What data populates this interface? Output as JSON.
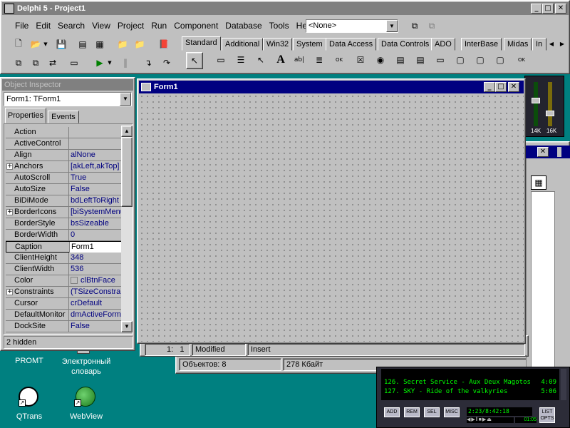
{
  "main_window": {
    "title": "Delphi 5 - Project1",
    "menu": [
      "File",
      "Edit",
      "Search",
      "View",
      "Project",
      "Run",
      "Component",
      "Database",
      "Tools",
      "Help"
    ],
    "component_combo": "<None>",
    "palette_tabs": [
      "Standard",
      "Additional",
      "Win32",
      "System",
      "Data Access",
      "Data Controls",
      "ADO",
      "InterBase",
      "Midas",
      "In"
    ],
    "palette_icon_letter": "A"
  },
  "object_inspector": {
    "title": "Object Inspector",
    "selected": "Form1: TForm1",
    "tabs": [
      "Properties",
      "Events"
    ],
    "rows": [
      {
        "name": "Action",
        "value": ""
      },
      {
        "name": "ActiveControl",
        "value": ""
      },
      {
        "name": "Align",
        "value": "alNone"
      },
      {
        "name": "Anchors",
        "value": "[akLeft,akTop]",
        "expand": "+"
      },
      {
        "name": "AutoScroll",
        "value": "True"
      },
      {
        "name": "AutoSize",
        "value": "False"
      },
      {
        "name": "BiDiMode",
        "value": "bdLeftToRight"
      },
      {
        "name": "BorderIcons",
        "value": "[biSystemMenu,",
        "expand": "+"
      },
      {
        "name": "BorderStyle",
        "value": "bsSizeable"
      },
      {
        "name": "BorderWidth",
        "value": "0"
      },
      {
        "name": "Caption",
        "value": "Form1"
      },
      {
        "name": "ClientHeight",
        "value": "348"
      },
      {
        "name": "ClientWidth",
        "value": "536"
      },
      {
        "name": "Color",
        "value": "clBtnFace"
      },
      {
        "name": "Constraints",
        "value": "(TSizeConstrain",
        "expand": "+"
      },
      {
        "name": "Cursor",
        "value": "crDefault"
      },
      {
        "name": "DefaultMonitor",
        "value": "dmActiveForm"
      },
      {
        "name": "DockSite",
        "value": "False"
      }
    ],
    "status": "2 hidden"
  },
  "form": {
    "title": "Form1"
  },
  "editor_status": {
    "position": "1:   1",
    "modified": "Modified",
    "mode": "Insert"
  },
  "explorer_status": {
    "objects": "Объектов: 8",
    "size": "278 Кбайт"
  },
  "desktop_icons": [
    {
      "label": "PROMT"
    },
    {
      "label": "Электронный словарь"
    },
    {
      "label": "QTrans"
    },
    {
      "label": "WebView"
    }
  ],
  "winamp": {
    "eq_labels": [
      "14K",
      "16K"
    ],
    "playlist": [
      {
        "text": "126. Secret Service - Aux Deux Magotos",
        "time": "4:09"
      },
      {
        "text": "127. SKY - Ride of the valkyries",
        "time": "5:06"
      }
    ],
    "buttons": [
      "ADD",
      "REM",
      "SEL",
      "MISC"
    ],
    "time_display": "2:23/8:42:18",
    "mini_time": "01:05",
    "list_opts_line1": "LIST",
    "list_opts_line2": "OPTS"
  }
}
